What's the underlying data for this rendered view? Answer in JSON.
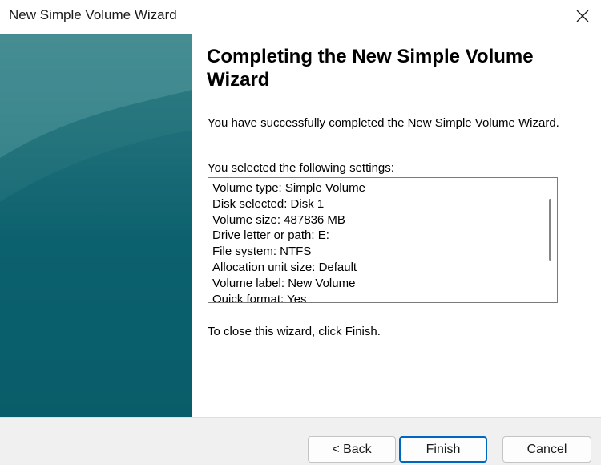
{
  "window": {
    "title": "New Simple Volume Wizard"
  },
  "page": {
    "heading": "Completing the New Simple Volume Wizard",
    "intro": "You have successfully completed the New Simple Volume Wizard.",
    "settings_label": "You selected the following settings:",
    "settings": [
      "Volume type: Simple Volume",
      "Disk selected: Disk 1",
      "Volume size: 487836 MB",
      "Drive letter or path: E:",
      "File system: NTFS",
      "Allocation unit size: Default",
      "Volume label: New Volume",
      "Quick format: Yes"
    ],
    "closing": "To close this wizard, click Finish."
  },
  "buttons": {
    "back": "< Back",
    "finish": "Finish",
    "cancel": "Cancel"
  },
  "colors": {
    "side_panel": "#0e6470",
    "default_button_border": "#0067c0"
  },
  "icons": {
    "close": "close-icon"
  }
}
